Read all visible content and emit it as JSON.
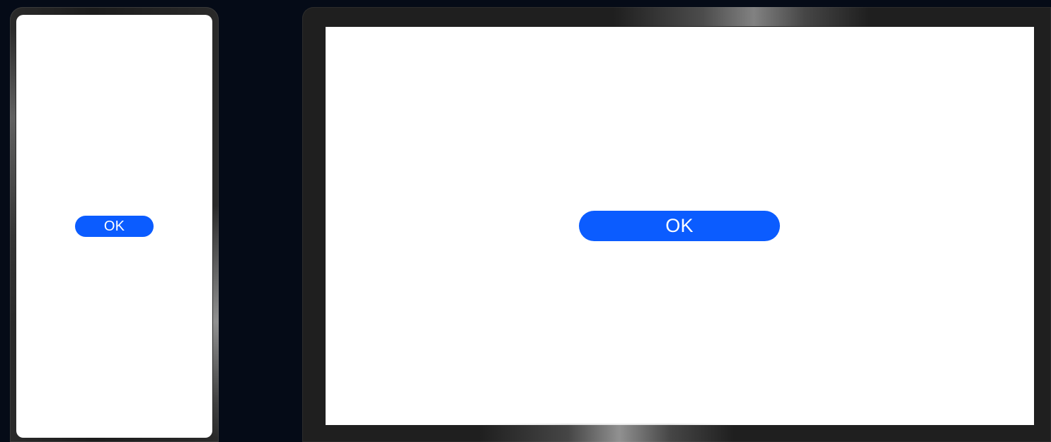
{
  "devices": {
    "phone": {
      "screen": {
        "ok_button_label": "OK"
      }
    },
    "tablet": {
      "screen": {
        "ok_button_label": "OK"
      }
    }
  },
  "colors": {
    "background": "#050b17",
    "device_bezel": "#1f1f1f",
    "screen": "#ffffff",
    "button_accent": "#0b5cff",
    "button_text": "#ffffff"
  }
}
